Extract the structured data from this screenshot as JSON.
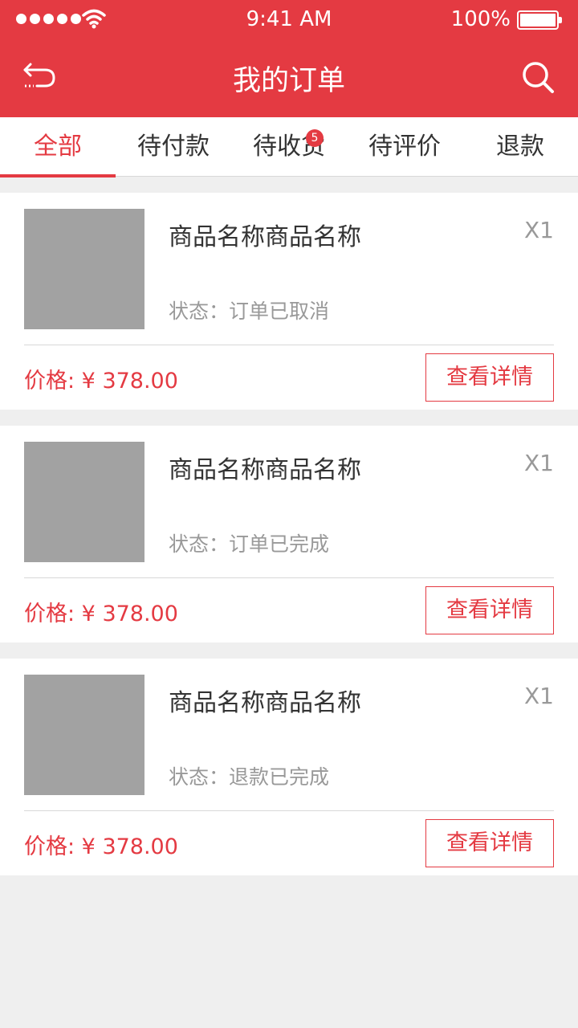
{
  "status_bar": {
    "time": "9:41 AM",
    "battery": "100%"
  },
  "header": {
    "title": "我的订单",
    "back_icon": "back-arrow-icon",
    "search_icon": "search-icon",
    "accent": "#e43a42"
  },
  "tabs": [
    {
      "label": "全部",
      "active": true
    },
    {
      "label": "待付款"
    },
    {
      "label": "待收货",
      "badge": "5"
    },
    {
      "label": "待评价"
    },
    {
      "label": "退款"
    }
  ],
  "orders": [
    {
      "name": "商品名称商品名称",
      "qty": "X1",
      "status": "状态：订单已取消",
      "price": "价格: ¥ 378.00",
      "button": "查看详情"
    },
    {
      "name": "商品名称商品名称",
      "qty": "X1",
      "status": "状态：订单已完成",
      "price": "价格: ¥ 378.00",
      "button": "查看详情"
    },
    {
      "name": "商品名称商品名称",
      "qty": "X1",
      "status": "状态：退款已完成",
      "price": "价格: ¥ 378.00",
      "button": "查看详情"
    }
  ]
}
